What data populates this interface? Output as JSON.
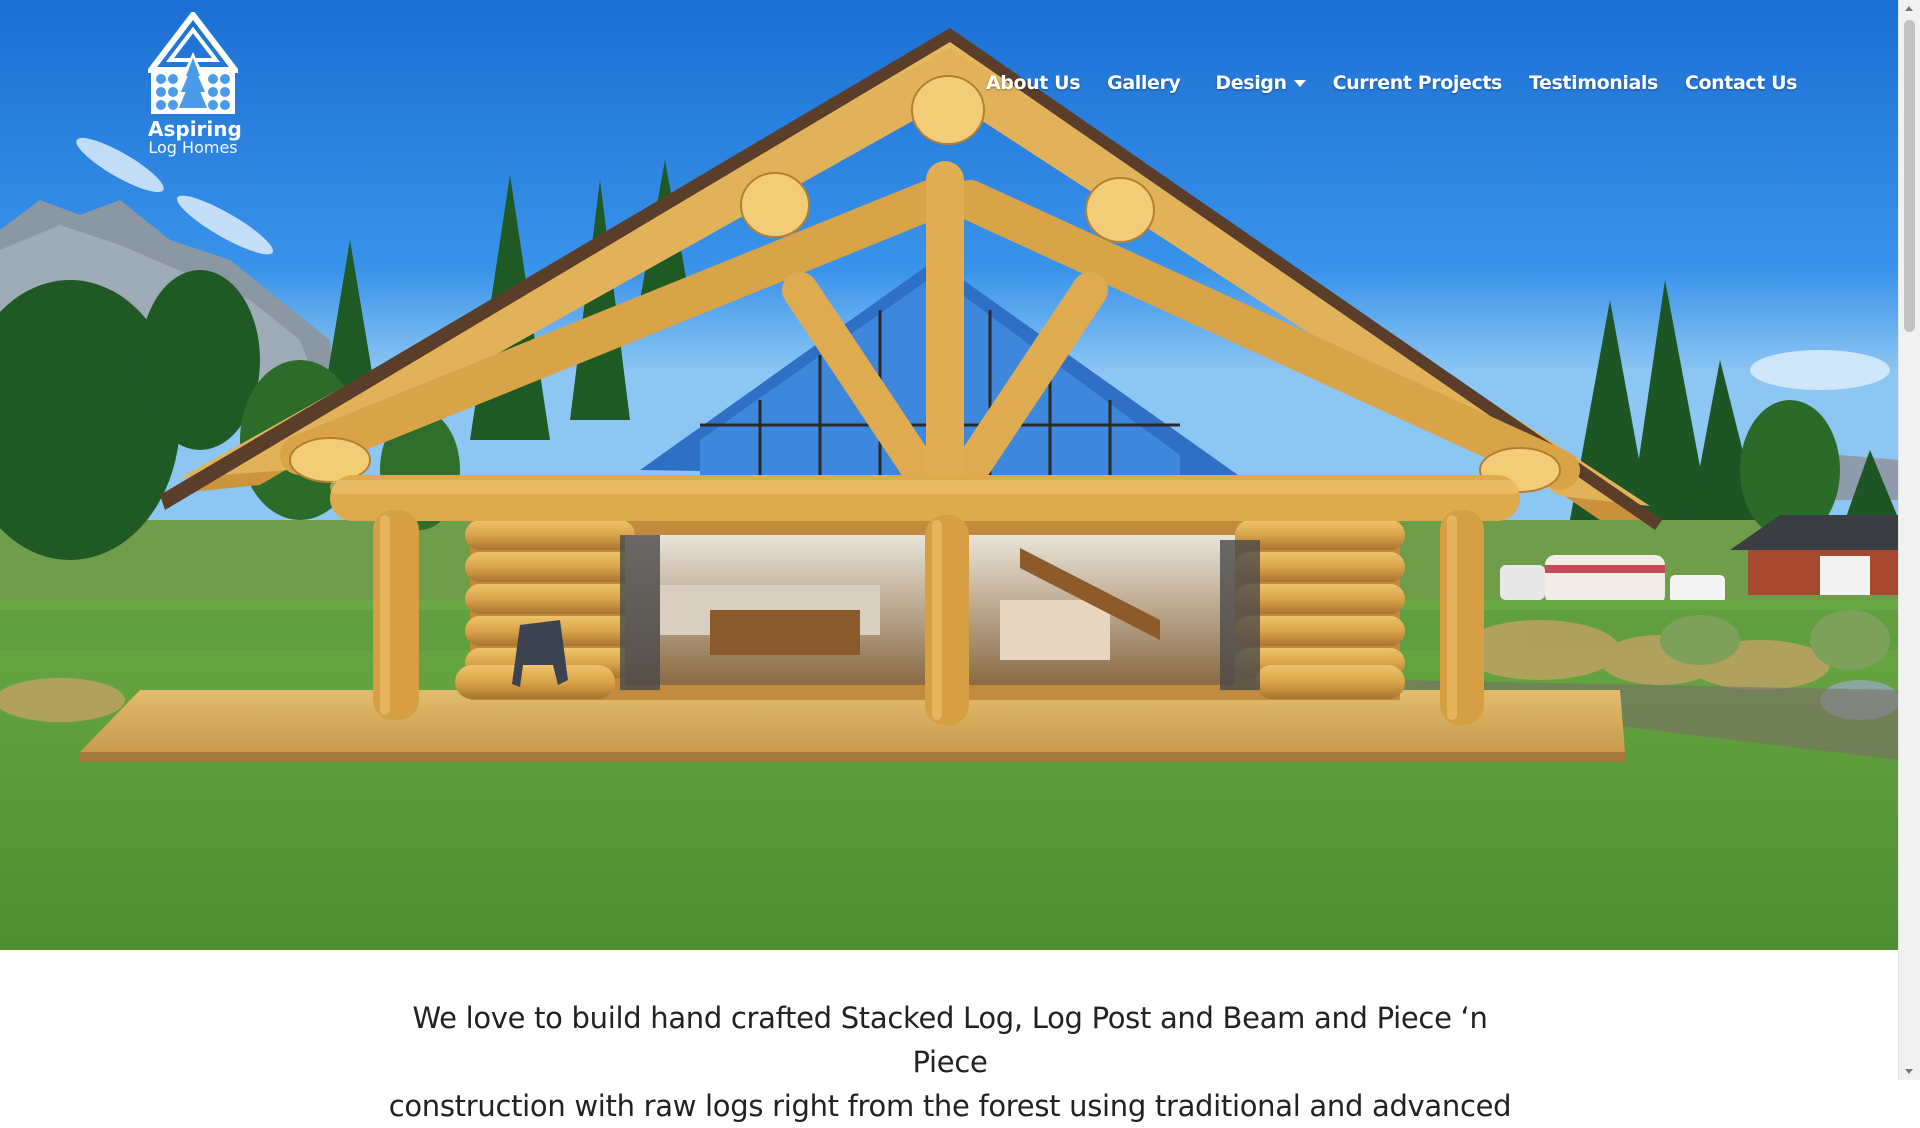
{
  "brand": {
    "name_line1": "Aspiring",
    "name_line2": "Log Homes",
    "logo_icon": "log-cabin-tree-logo-icon"
  },
  "nav": {
    "items": [
      {
        "label": "About Us"
      },
      {
        "label": "Gallery"
      },
      {
        "label": "Design",
        "icon": "caret-down-icon"
      },
      {
        "label": "Current Projects"
      },
      {
        "label": "Testimonials"
      },
      {
        "label": "Contact Us"
      }
    ]
  },
  "hero": {
    "image": "log-home-photo"
  },
  "intro": {
    "line1": "We love to build hand crafted Stacked Log, Log Post and Beam and Piece ‘n Piece",
    "line2": "construction with raw logs right from the forest using traditional and advanced"
  },
  "colors": {
    "sky": "#2f86e3",
    "grass": "#5a9a3a",
    "timber": "#d9a84a",
    "roof_edge": "#6b4b33",
    "text": "#222222",
    "nav_text": "#ffffff"
  }
}
